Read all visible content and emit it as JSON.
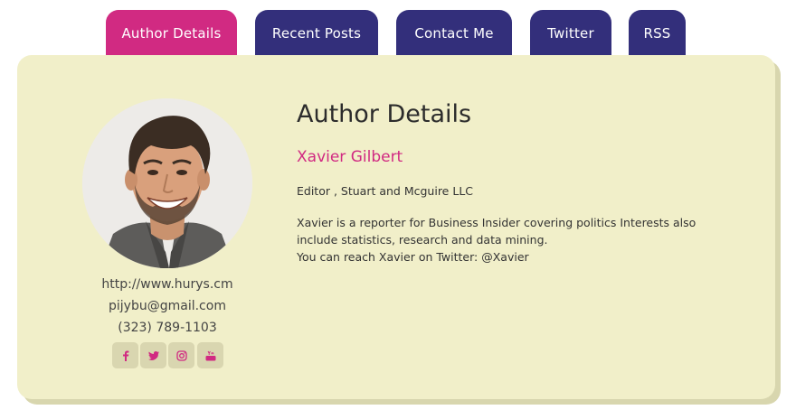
{
  "tabs": [
    {
      "label": "Author Details",
      "active": true
    },
    {
      "label": "Recent Posts",
      "active": false
    },
    {
      "label": "Contact Me",
      "active": false
    },
    {
      "label": "Twitter",
      "active": false
    },
    {
      "label": "RSS",
      "active": false
    }
  ],
  "profile": {
    "website": "http://www.hurys.cm",
    "email": "pijybu@gmail.com",
    "phone": "(323) 789-1103",
    "social_icons": [
      "facebook-icon",
      "twitter-icon",
      "instagram-icon",
      "youtube-icon"
    ]
  },
  "details": {
    "title": "Author Details",
    "name": "Xavier Gilbert",
    "role": "Editor , Stuart and Mcguire LLC",
    "bio_line1": "Xavier is a reporter for Business Insider covering politics Interests also",
    "bio_line2": "include statistics, research and data mining.",
    "bio_line3": "You can reach Xavier on Twitter: @Xavier"
  },
  "colors": {
    "active_tab": "#d12a82",
    "inactive_tab": "#332f7b",
    "card_background": "#f1efc9",
    "accent": "#d12a82"
  }
}
